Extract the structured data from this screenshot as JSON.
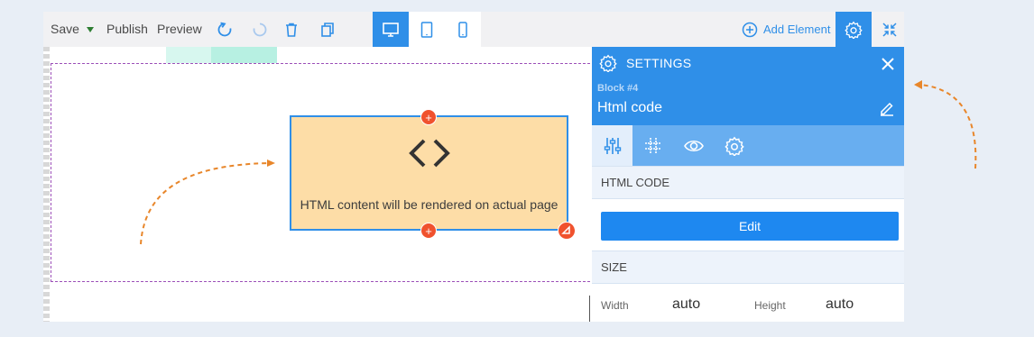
{
  "toolbar": {
    "save_label": "Save",
    "publish_label": "Publish",
    "preview_label": "Preview",
    "add_element_label": "Add Element",
    "icons": [
      "undo-icon",
      "redo-icon",
      "trash-icon",
      "copy-icon",
      "desktop-icon",
      "tablet-icon",
      "mobile-icon",
      "plus-circle-icon",
      "gear-icon",
      "collapse-icon"
    ],
    "active_device": "desktop"
  },
  "canvas": {
    "block_text": "HTML content will be rendered on actual page",
    "block_icon": "code-icon"
  },
  "settings": {
    "title": "SETTINGS",
    "block_number": "Block #4",
    "block_name": "Html code",
    "tabs": [
      "sliders-icon",
      "grid-icon",
      "eye-icon",
      "gear-icon"
    ],
    "html_code_header": "HTML CODE",
    "edit_button": "Edit",
    "size_header": "SIZE",
    "width_label": "Width",
    "width_value": "auto",
    "height_label": "Height",
    "height_value": "auto"
  },
  "colors": {
    "accent": "#2f8fe8",
    "block_fill": "#fddda7",
    "handle": "#f0522e",
    "arrow": "#e8862a",
    "section_outline": "#9c4fb8"
  }
}
